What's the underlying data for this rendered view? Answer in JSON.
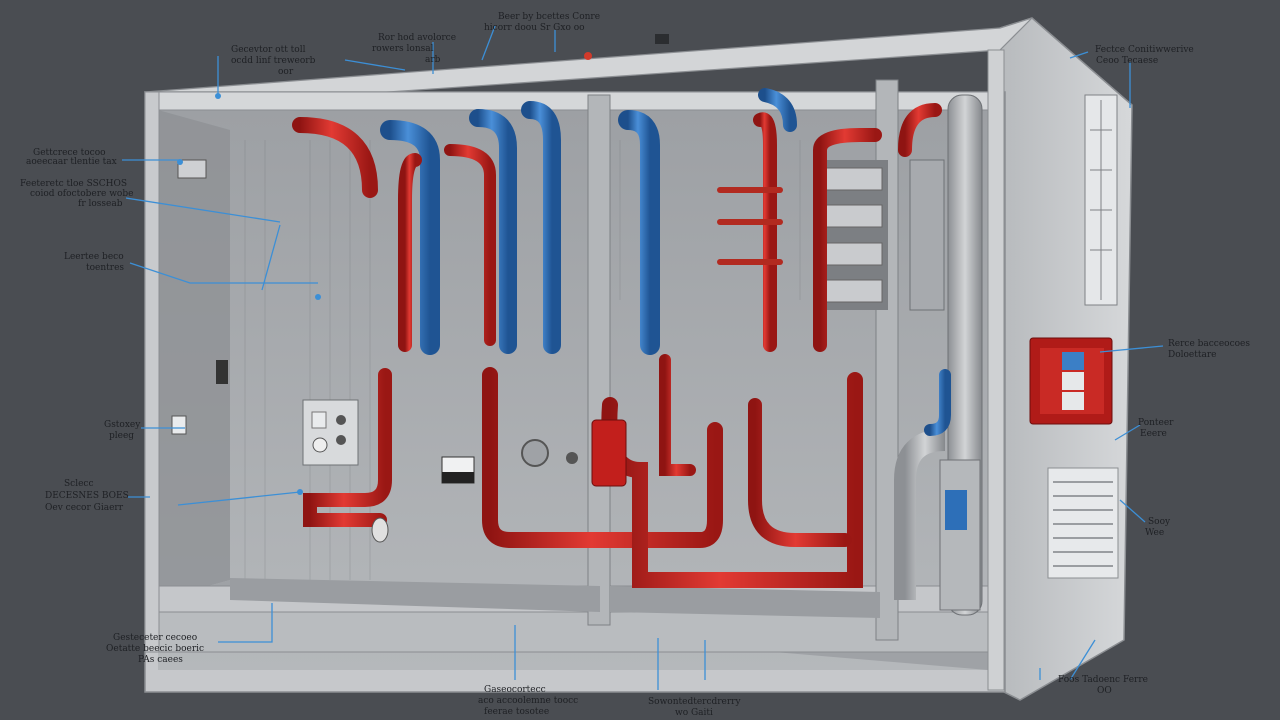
{
  "palette": {
    "background": "#4a4d52",
    "cabinet": "#c9cbcd",
    "cabinet_dark": "#8f9296",
    "interior": "#a9acaf",
    "hot_pipe": "#c8211f",
    "cold_pipe": "#2d6fb8",
    "leader_line": "#3c8fd6"
  },
  "callouts": {
    "top_left": [
      "Gecevtor ott toll",
      "ocdd linf treweorb",
      "oor"
    ],
    "top_center_left": [
      "Ror hod avolorce",
      "rowers lonsal",
      "arb"
    ],
    "top_center": [
      "Beer by bcettes Conre",
      "hicorr doou Sr Gxo oo"
    ],
    "top_right": [
      "Fectce Conitiwwerive",
      "Ceoo Tecaese"
    ],
    "left_1": [
      "Gettcrece tocoo",
      "aoeecaar tlentie tax"
    ],
    "left_2": [
      "Feeteretc tloe SSCHOS",
      "coiod ofoctobere wobe",
      "fr losseab"
    ],
    "left_3": [
      "Leertee beco",
      "toentres"
    ],
    "left_4": [
      "Gstoxey",
      "pleeg"
    ],
    "left_5": [
      "Sclecc",
      "DECESNES BOES",
      "Oev cecor Giaerr"
    ],
    "bottom_left": [
      "Gesteceter cecoeo",
      "Oetatte beecic boeric",
      "PAs caees"
    ],
    "bottom_center": [
      "Gaseocortecc",
      "aco accoolemne toocc",
      "feerae tosotee"
    ],
    "bottom_center_right": [
      "Sowontedtercdrerry",
      "wo Gaiti"
    ],
    "bottom_right": [
      "Foos Tadoenc Ferre",
      "OO"
    ],
    "right_1": [
      "Rerce bacceocoes",
      "Doloettare"
    ],
    "right_2": [
      "Ponteer",
      "Eeere"
    ],
    "right_3": [
      "Sooy",
      "Wee"
    ]
  }
}
